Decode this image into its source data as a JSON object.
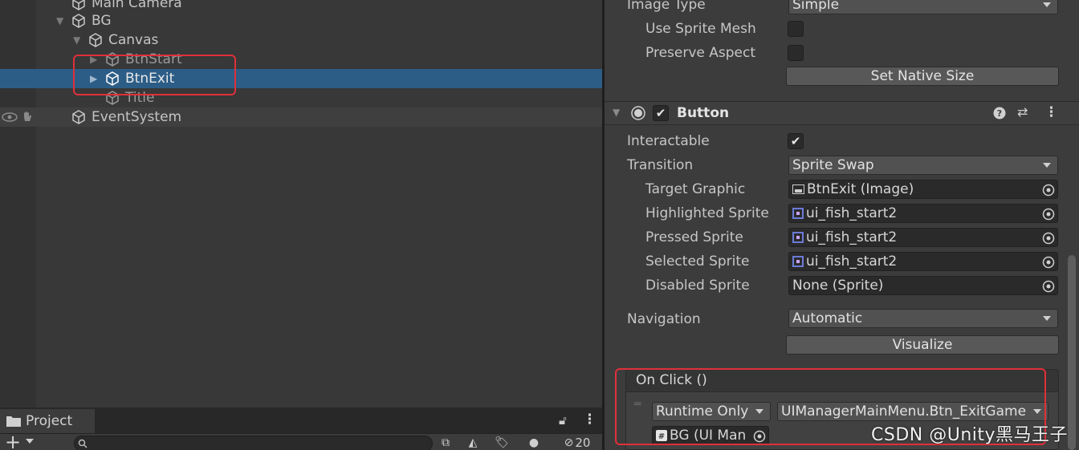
{
  "hierarchy": {
    "items": [
      {
        "label": "Main Camera"
      },
      {
        "label": "BG"
      },
      {
        "label": "Canvas"
      },
      {
        "label": "BtnStart"
      },
      {
        "label": "BtnExit"
      },
      {
        "label": "Title"
      },
      {
        "label": "EventSystem"
      }
    ]
  },
  "inspector": {
    "image": {
      "image_type_label": "Image Type",
      "image_type_value": "Simple",
      "use_sprite_mesh_label": "Use Sprite Mesh",
      "use_sprite_mesh_checked": false,
      "preserve_aspect_label": "Preserve Aspect",
      "preserve_aspect_checked": false,
      "set_native_size_label": "Set Native Size"
    },
    "button": {
      "title": "Button",
      "enabled": true,
      "interactable_label": "Interactable",
      "interactable_checked": true,
      "transition_label": "Transition",
      "transition_value": "Sprite Swap",
      "target_graphic_label": "Target Graphic",
      "target_graphic_value": "BtnExit (Image)",
      "highlighted_label": "Highlighted Sprite",
      "highlighted_value": "ui_fish_start2",
      "pressed_label": "Pressed Sprite",
      "pressed_value": "ui_fish_start2",
      "selected_label": "Selected Sprite",
      "selected_value": "ui_fish_start2",
      "disabled_label": "Disabled Sprite",
      "disabled_value": "None (Sprite)",
      "navigation_label": "Navigation",
      "navigation_value": "Automatic",
      "visualize_label": "Visualize",
      "on_click_label": "On Click ()",
      "runtime_value": "Runtime Only",
      "function_value": "UIManagerMainMenu.Btn_ExitGame",
      "object_value": "BG (UI Man"
    }
  },
  "project": {
    "tab_label": "Project",
    "hidden_count": "20",
    "search_placeholder": ""
  },
  "watermark": "CSDN @Unity黑马王子",
  "colors": {
    "selection": "#2c5d87",
    "highlight_box": "#e0303a",
    "sprite_icon": "#6b7bd8"
  }
}
